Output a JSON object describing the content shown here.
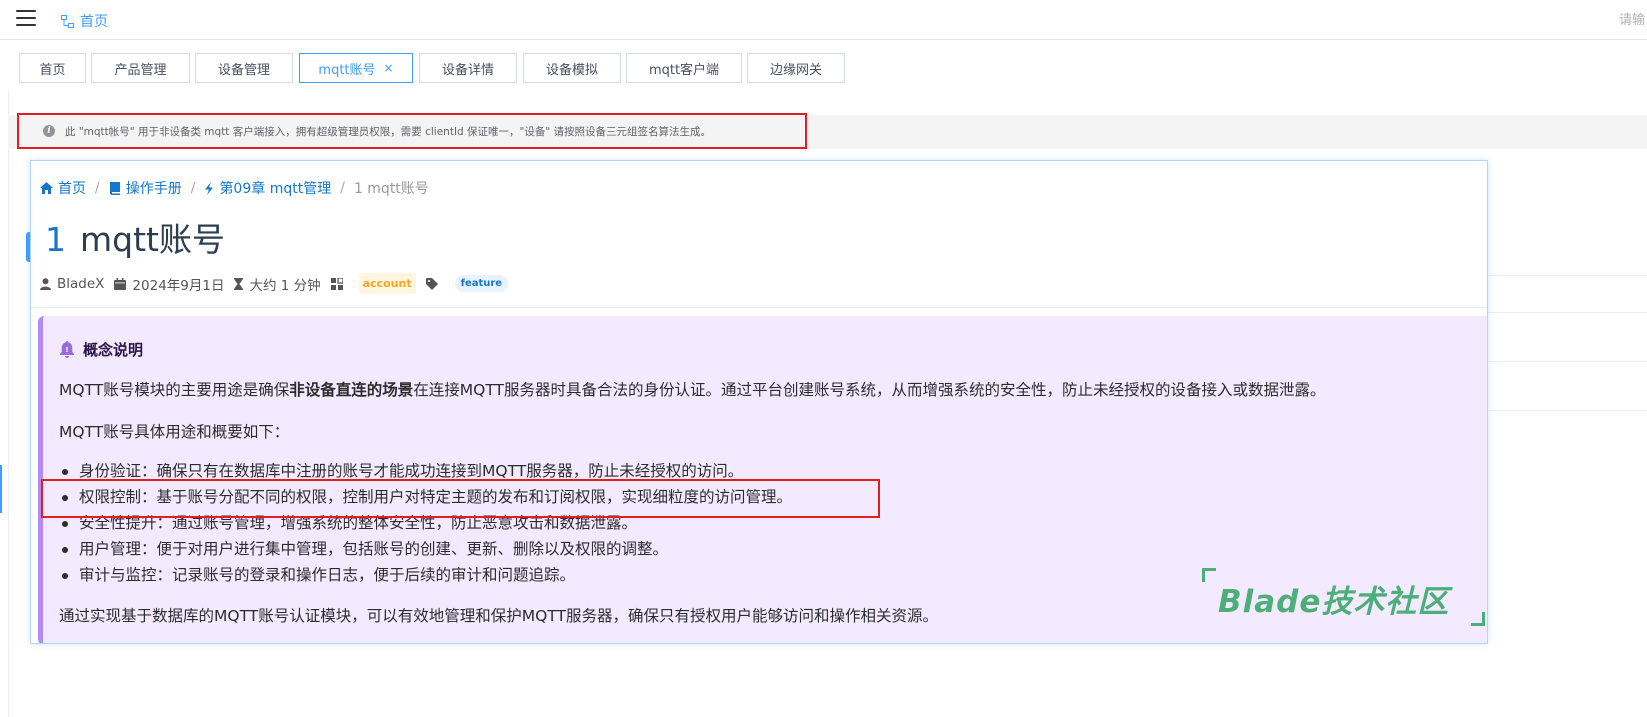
{
  "navbar": {
    "home_label": "首页",
    "search_hint": "请输"
  },
  "tabs": [
    {
      "label": "首页",
      "active": false
    },
    {
      "label": "产品管理",
      "active": false
    },
    {
      "label": "设备管理",
      "active": false
    },
    {
      "label": "mqtt账号",
      "active": true,
      "close": "×"
    },
    {
      "label": "设备详情",
      "active": false
    },
    {
      "label": "设备模拟",
      "active": false
    },
    {
      "label": "mqtt客户端",
      "active": false
    },
    {
      "label": "边缘网关",
      "active": false
    }
  ],
  "notice": {
    "text": "此 \"mqtt帐号\" 用于非设备类 mqtt 客户端接入，拥有超级管理员权限，需要 clientId 保证唯一，\"设备\" 请按照设备三元组签名算法生成。"
  },
  "doc": {
    "breadcrumb": [
      {
        "label": "首页",
        "icon": "home-icon"
      },
      {
        "label": "操作手册",
        "icon": "book-icon"
      },
      {
        "label": "第09章 mqtt管理",
        "icon": "bolt-icon"
      },
      {
        "label": "1  mqtt账号",
        "icon": ""
      }
    ],
    "breadcrumb_sep": "/",
    "title_number": "1",
    "title_text": "mqtt账号",
    "meta": {
      "author": "BladeX",
      "date": "2024年9月1日",
      "reading_time": "大约 1 分钟",
      "category": "account",
      "tag": "feature"
    },
    "concept": {
      "title": "概念说明",
      "intro_before": "MQTT账号模块的主要用途是确保",
      "intro_bold": "非设备直连的场景",
      "intro_after": "在连接MQTT服务器时具备合法的身份认证。通过平台创建账号系统，从而增强系统的安全性，防止未经授权的设备接入或数据泄露。",
      "subtitle": "MQTT账号具体用途和概要如下：",
      "items": [
        "身份验证：确保只有在数据库中注册的账号才能成功连接到MQTT服务器，防止未经授权的访问。",
        "权限控制：基于账号分配不同的权限，控制用户对特定主题的发布和订阅权限，实现细粒度的访问管理。",
        "安全性提升：通过账号管理，增强系统的整体安全性，防止恶意攻击和数据泄露。",
        "用户管理：便于对用户进行集中管理，包括账号的创建、更新、删除以及权限的调整。",
        "审计与监控：记录账号的登录和操作日志，便于后续的审计和问题追踪。"
      ],
      "conclusion": "通过实现基于数据库的MQTT账号认证模块，可以有效地管理和保护MQTT服务器，确保只有授权用户能够访问和操作相关资源。"
    }
  },
  "watermark": {
    "text": "Blade技术社区"
  },
  "colors": {
    "accent": "#409eff",
    "link": "#1677c9",
    "highlight_border": "#e02020",
    "concept_bg": "#f4eaff",
    "concept_border": "#b18af2",
    "watermark": "#4caf7a"
  }
}
